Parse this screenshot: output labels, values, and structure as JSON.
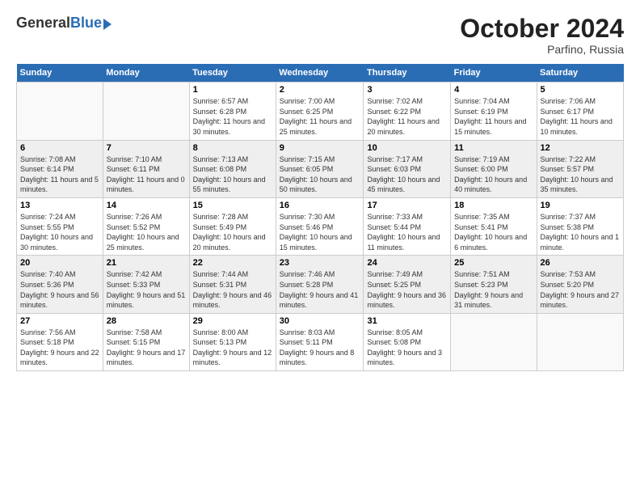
{
  "logo": {
    "general": "General",
    "blue": "Blue"
  },
  "title": "October 2024",
  "location": "Parfino, Russia",
  "days_header": [
    "Sunday",
    "Monday",
    "Tuesday",
    "Wednesday",
    "Thursday",
    "Friday",
    "Saturday"
  ],
  "weeks": [
    [
      {
        "num": "",
        "info": ""
      },
      {
        "num": "",
        "info": ""
      },
      {
        "num": "1",
        "info": "Sunrise: 6:57 AM\nSunset: 6:28 PM\nDaylight: 11 hours and 30 minutes."
      },
      {
        "num": "2",
        "info": "Sunrise: 7:00 AM\nSunset: 6:25 PM\nDaylight: 11 hours and 25 minutes."
      },
      {
        "num": "3",
        "info": "Sunrise: 7:02 AM\nSunset: 6:22 PM\nDaylight: 11 hours and 20 minutes."
      },
      {
        "num": "4",
        "info": "Sunrise: 7:04 AM\nSunset: 6:19 PM\nDaylight: 11 hours and 15 minutes."
      },
      {
        "num": "5",
        "info": "Sunrise: 7:06 AM\nSunset: 6:17 PM\nDaylight: 11 hours and 10 minutes."
      }
    ],
    [
      {
        "num": "6",
        "info": "Sunrise: 7:08 AM\nSunset: 6:14 PM\nDaylight: 11 hours and 5 minutes."
      },
      {
        "num": "7",
        "info": "Sunrise: 7:10 AM\nSunset: 6:11 PM\nDaylight: 11 hours and 0 minutes."
      },
      {
        "num": "8",
        "info": "Sunrise: 7:13 AM\nSunset: 6:08 PM\nDaylight: 10 hours and 55 minutes."
      },
      {
        "num": "9",
        "info": "Sunrise: 7:15 AM\nSunset: 6:05 PM\nDaylight: 10 hours and 50 minutes."
      },
      {
        "num": "10",
        "info": "Sunrise: 7:17 AM\nSunset: 6:03 PM\nDaylight: 10 hours and 45 minutes."
      },
      {
        "num": "11",
        "info": "Sunrise: 7:19 AM\nSunset: 6:00 PM\nDaylight: 10 hours and 40 minutes."
      },
      {
        "num": "12",
        "info": "Sunrise: 7:22 AM\nSunset: 5:57 PM\nDaylight: 10 hours and 35 minutes."
      }
    ],
    [
      {
        "num": "13",
        "info": "Sunrise: 7:24 AM\nSunset: 5:55 PM\nDaylight: 10 hours and 30 minutes."
      },
      {
        "num": "14",
        "info": "Sunrise: 7:26 AM\nSunset: 5:52 PM\nDaylight: 10 hours and 25 minutes."
      },
      {
        "num": "15",
        "info": "Sunrise: 7:28 AM\nSunset: 5:49 PM\nDaylight: 10 hours and 20 minutes."
      },
      {
        "num": "16",
        "info": "Sunrise: 7:30 AM\nSunset: 5:46 PM\nDaylight: 10 hours and 15 minutes."
      },
      {
        "num": "17",
        "info": "Sunrise: 7:33 AM\nSunset: 5:44 PM\nDaylight: 10 hours and 11 minutes."
      },
      {
        "num": "18",
        "info": "Sunrise: 7:35 AM\nSunset: 5:41 PM\nDaylight: 10 hours and 6 minutes."
      },
      {
        "num": "19",
        "info": "Sunrise: 7:37 AM\nSunset: 5:38 PM\nDaylight: 10 hours and 1 minute."
      }
    ],
    [
      {
        "num": "20",
        "info": "Sunrise: 7:40 AM\nSunset: 5:36 PM\nDaylight: 9 hours and 56 minutes."
      },
      {
        "num": "21",
        "info": "Sunrise: 7:42 AM\nSunset: 5:33 PM\nDaylight: 9 hours and 51 minutes."
      },
      {
        "num": "22",
        "info": "Sunrise: 7:44 AM\nSunset: 5:31 PM\nDaylight: 9 hours and 46 minutes."
      },
      {
        "num": "23",
        "info": "Sunrise: 7:46 AM\nSunset: 5:28 PM\nDaylight: 9 hours and 41 minutes."
      },
      {
        "num": "24",
        "info": "Sunrise: 7:49 AM\nSunset: 5:25 PM\nDaylight: 9 hours and 36 minutes."
      },
      {
        "num": "25",
        "info": "Sunrise: 7:51 AM\nSunset: 5:23 PM\nDaylight: 9 hours and 31 minutes."
      },
      {
        "num": "26",
        "info": "Sunrise: 7:53 AM\nSunset: 5:20 PM\nDaylight: 9 hours and 27 minutes."
      }
    ],
    [
      {
        "num": "27",
        "info": "Sunrise: 7:56 AM\nSunset: 5:18 PM\nDaylight: 9 hours and 22 minutes."
      },
      {
        "num": "28",
        "info": "Sunrise: 7:58 AM\nSunset: 5:15 PM\nDaylight: 9 hours and 17 minutes."
      },
      {
        "num": "29",
        "info": "Sunrise: 8:00 AM\nSunset: 5:13 PM\nDaylight: 9 hours and 12 minutes."
      },
      {
        "num": "30",
        "info": "Sunrise: 8:03 AM\nSunset: 5:11 PM\nDaylight: 9 hours and 8 minutes."
      },
      {
        "num": "31",
        "info": "Sunrise: 8:05 AM\nSunset: 5:08 PM\nDaylight: 9 hours and 3 minutes."
      },
      {
        "num": "",
        "info": ""
      },
      {
        "num": "",
        "info": ""
      }
    ]
  ]
}
